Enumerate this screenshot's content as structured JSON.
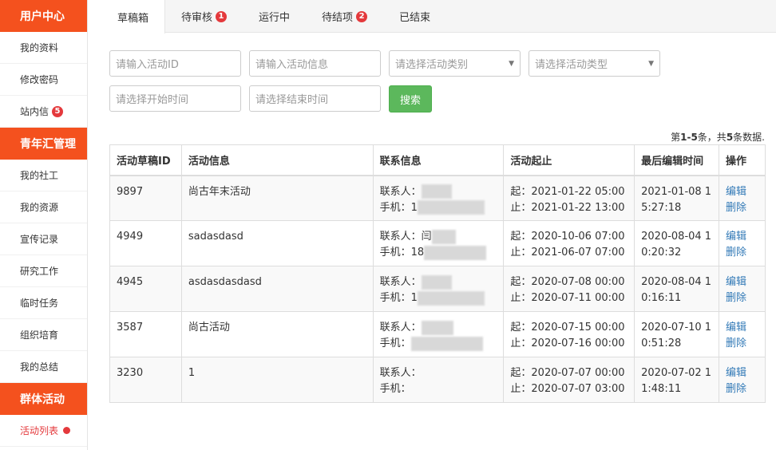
{
  "sidebar": {
    "sections": [
      {
        "title": "用户中心",
        "items": [
          {
            "label": "我的资料"
          },
          {
            "label": "修改密码"
          },
          {
            "label": "站内信",
            "badge": "5"
          }
        ]
      },
      {
        "title": "青年汇管理",
        "items": [
          {
            "label": "我的社工"
          },
          {
            "label": "我的资源"
          },
          {
            "label": "宣传记录"
          },
          {
            "label": "研究工作"
          },
          {
            "label": "临时任务"
          },
          {
            "label": "组织培育"
          },
          {
            "label": "我的总结"
          }
        ]
      },
      {
        "title": "群体活动",
        "items": [
          {
            "label": "活动列表",
            "active": true
          }
        ]
      }
    ]
  },
  "tabs": [
    {
      "label": "草稿箱",
      "active": true
    },
    {
      "label": "待审核",
      "badge": "1"
    },
    {
      "label": "运行中"
    },
    {
      "label": "待结项",
      "badge": "2"
    },
    {
      "label": "已结束"
    }
  ],
  "filters": {
    "activity_id_placeholder": "请输入活动ID",
    "activity_info_placeholder": "请输入活动信息",
    "category_placeholder": "请选择活动类别",
    "type_placeholder": "请选择活动类型",
    "start_time_placeholder": "请选择开始时间",
    "end_time_placeholder": "请选择结束时间",
    "search_label": "搜索"
  },
  "summary": {
    "prefix": "第",
    "range": "1-5",
    "middle": "条，共",
    "total": "5",
    "suffix": "条数据."
  },
  "table": {
    "headers": [
      "活动草稿ID",
      "活动信息",
      "联系信息",
      "活动起止",
      "最后编辑时间",
      "操作"
    ],
    "contact_label": "联系人：",
    "phone_label": "手机：",
    "edit_label": "编辑",
    "delete_label": "删除",
    "rows": [
      {
        "id": "9897",
        "info": "尚古年末活动",
        "contact_prefix": "",
        "phone_prefix": "1",
        "start": "起：2021-01-22 05:00",
        "end": "止：2021-01-22 13:00",
        "edited_1": "2021-01-08 1",
        "edited_2": "5:27:18"
      },
      {
        "id": "4949",
        "info": "sadasdasd",
        "contact_prefix": "闫",
        "phone_prefix": "18",
        "start": "起：2020-10-06 07:00",
        "end": "止：2021-06-07 07:00",
        "edited_1": "2020-08-04 1",
        "edited_2": "0:20:32"
      },
      {
        "id": "4945",
        "info": "asdasdasdasd",
        "contact_prefix": "",
        "phone_prefix": "1",
        "start": "起：2020-07-08 00:00",
        "end": "止：2020-07-11 00:00",
        "edited_1": "2020-08-04 1",
        "edited_2": "0:16:11"
      },
      {
        "id": "3587",
        "info": "尚古活动",
        "contact_prefix": "",
        "phone_prefix": "",
        "start": "起：2020-07-15 00:00",
        "end": "止：2020-07-16 00:00",
        "edited_1": "2020-07-10 1",
        "edited_2": "0:51:28"
      },
      {
        "id": "3230",
        "info": "1",
        "contact_prefix": "",
        "phone_prefix": "",
        "start": "起：2020-07-07 00:00",
        "end": "止：2020-07-07 03:00",
        "edited_1": "2020-07-02 1",
        "edited_2": "1:48:11"
      }
    ]
  }
}
